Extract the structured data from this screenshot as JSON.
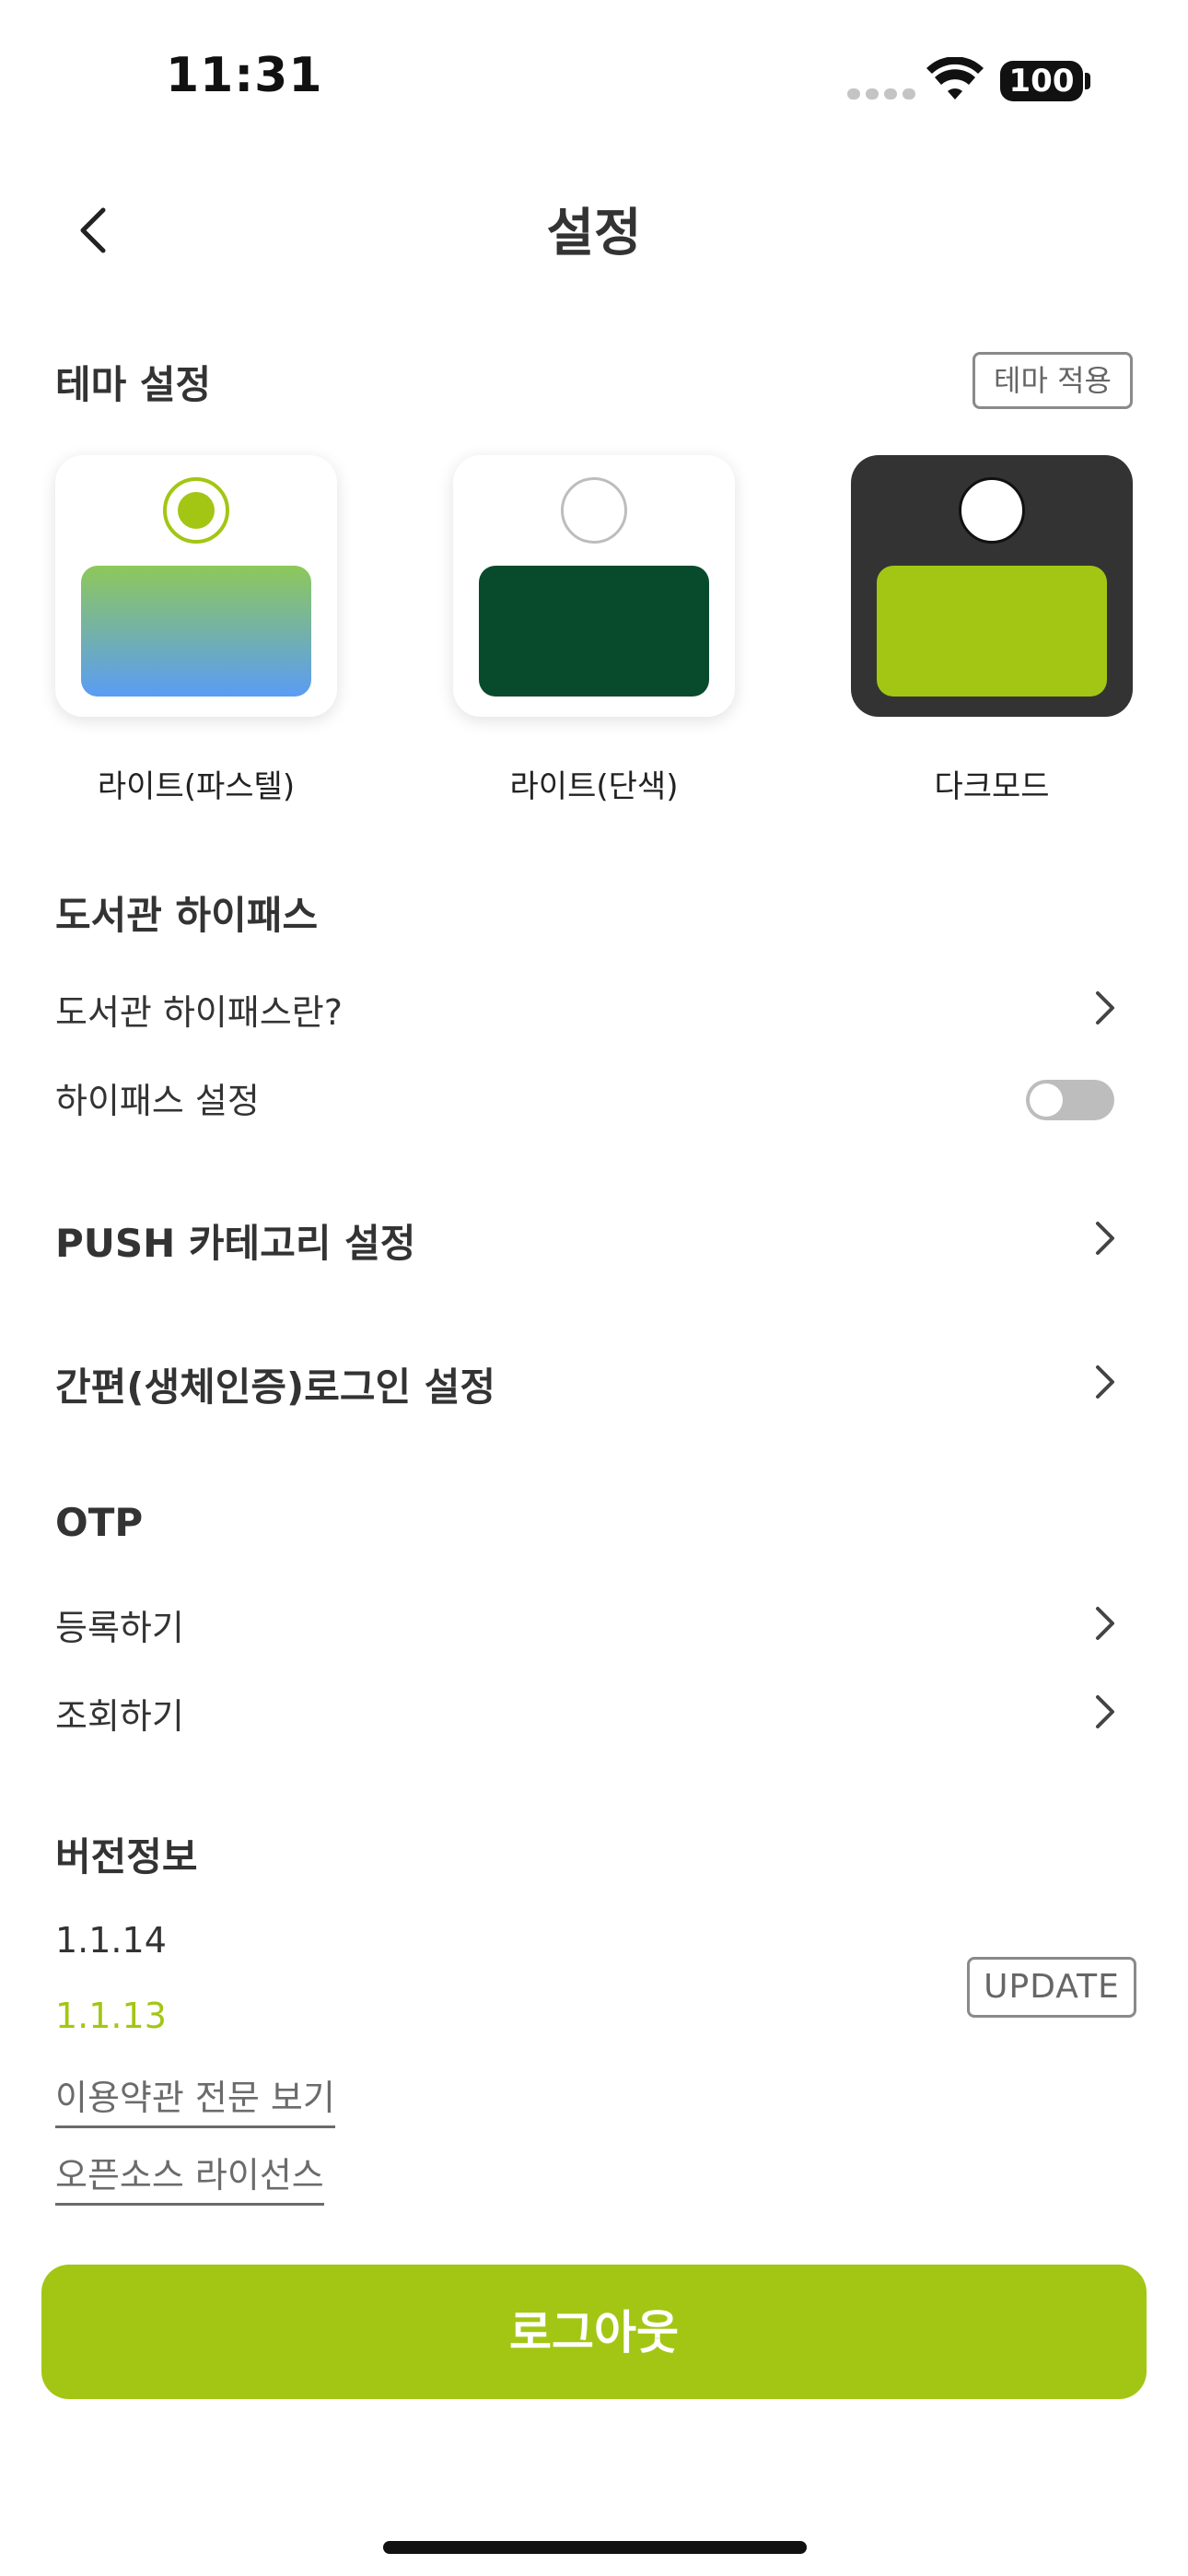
{
  "status_bar": {
    "time": "11:31",
    "battery": "100"
  },
  "header": {
    "title": "설정",
    "back_icon": "chevron-left-icon"
  },
  "theme": {
    "title": "테마 설정",
    "apply_label": "테마 적용",
    "options": [
      {
        "label": "라이트(파스텔)",
        "selected": true
      },
      {
        "label": "라이트(단색)",
        "selected": false
      },
      {
        "label": "다크모드",
        "selected": false
      }
    ]
  },
  "hipass": {
    "title": "도서관 하이패스",
    "about_label": "도서관 하이패스란?",
    "setting_label": "하이패스 설정",
    "enabled": false
  },
  "push": {
    "title": "PUSH 카테고리 설정"
  },
  "biometric": {
    "title": "간편(생체인증)로그인 설정"
  },
  "otp": {
    "title": "OTP",
    "register_label": "등록하기",
    "view_label": "조회하기"
  },
  "version": {
    "title": "버전정보",
    "latest": "1.1.14",
    "current": "1.1.13",
    "update_label": "UPDATE",
    "terms_label": "이용약관 전문 보기",
    "license_label": "오픈소스 라이선스"
  },
  "logout_label": "로그아웃",
  "colors": {
    "accent": "#a3c614",
    "dark_card": "#333333",
    "solid_green": "#084b2c",
    "pastel_top": "#8ec85a",
    "pastel_bottom": "#5a9cf5"
  }
}
